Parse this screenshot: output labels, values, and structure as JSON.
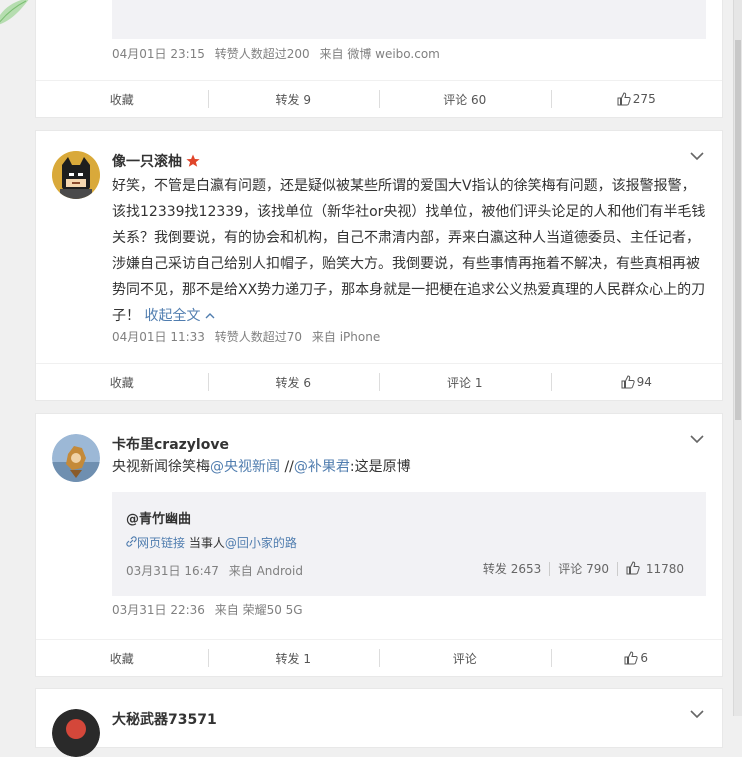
{
  "post0": {
    "meta_time": "04月01日 23:15",
    "meta_reposts": "转赞人数超过200",
    "meta_source": "来自 微博 weibo.com",
    "actions": {
      "fav": "收藏",
      "repost": "转发 9",
      "comment": "评论 60",
      "like": "275"
    }
  },
  "post1": {
    "username": "像一只滚柚",
    "text": "好笑，不管是白瀛有问题，还是疑似被某些所谓的爱国大V指认的徐笑梅有问题，该报警报警，该找12339找12339，该找单位（新华社or央视）找单位，被他们评头论足的人和他们有半毛钱关系？我倒要说，有的协会和机构，自己不肃清内部，弄来白瀛这种人当道德委员、主任记者，涉嫌自己采访自己给别人扣帽子，贻笑大方。我倒要说，有些事情再拖着不解决，有些真相再被势同不见，那不是给XX势力递刀子，那本身就是一把梗在追求公义热爱真理的人民群众心上的刀子！",
    "collapse": "收起全文",
    "meta_time": "04月01日 11:33",
    "meta_reposts": "转赞人数超过70",
    "meta_source": "来自 iPhone",
    "actions": {
      "fav": "收藏",
      "repost": "转发 6",
      "comment": "评论 1",
      "like": "94"
    }
  },
  "post2": {
    "username": "卡布里crazylove",
    "text_prefix": "央视新闻徐笑梅",
    "mention1": "@央视新闻",
    "sep": " //",
    "mention2": "@补果君",
    "text_suffix": ":这是原博",
    "quote": {
      "author": "@青竹幽曲",
      "link": "网页链接",
      "text": " 当事人",
      "mention": "@回小家的路",
      "time": "03月31日 16:47",
      "source": "来自 Android",
      "repost": "转发 2653",
      "comment": "评论 790",
      "like": "11780"
    },
    "meta_time": "03月31日 22:36",
    "meta_source": "来自 荣耀50 5G",
    "actions": {
      "fav": "收藏",
      "repost": "转发 1",
      "comment": "评论",
      "like": "6"
    }
  },
  "post3": {
    "username": "大秘武器73571"
  },
  "colors": {
    "link": "#507daf",
    "star": "#e0452a",
    "text": "#333333",
    "meta": "#808080"
  }
}
